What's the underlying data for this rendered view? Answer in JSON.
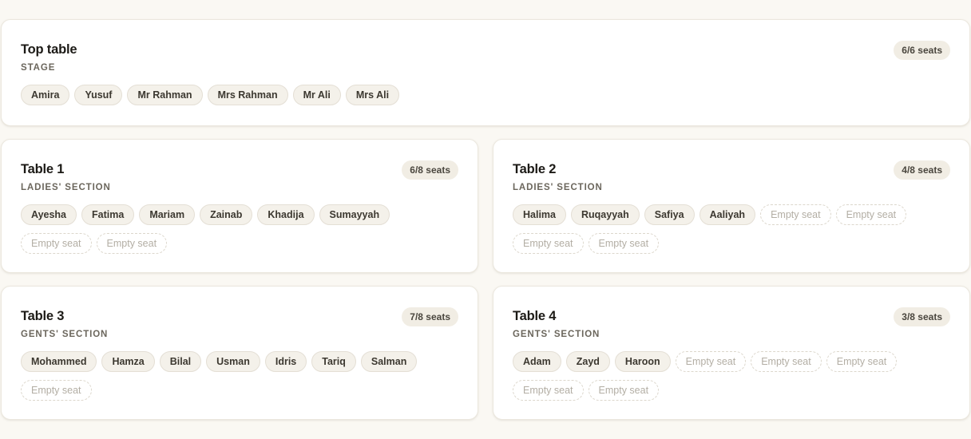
{
  "tables": [
    {
      "name": "Top table",
      "section": "STAGE",
      "seats": "6/6 seats",
      "guests": [
        "Amira",
        "Yusuf",
        "Mr Rahman",
        "Mrs Rahman",
        "Mr Ali",
        "Mrs Ali"
      ]
    },
    {
      "name": "Table 1",
      "section": "LADIES' SECTION",
      "seats": "6/8 seats",
      "guests": [
        "Ayesha",
        "Fatima",
        "Mariam",
        "Zainab",
        "Khadija",
        "Sumayyah",
        "Empty seat",
        "Empty seat"
      ]
    },
    {
      "name": "Table 2",
      "section": "LADIES' SECTION",
      "seats": "4/8 seats",
      "guests": [
        "Halima",
        "Ruqayyah",
        "Safiya",
        "Aaliyah",
        "Empty seat",
        "Empty seat",
        "Empty seat",
        "Empty seat"
      ]
    },
    {
      "name": "Table 3",
      "section": "GENTS' SECTION",
      "seats": "7/8 seats",
      "guests": [
        "Mohammed",
        "Hamza",
        "Bilal",
        "Usman",
        "Idris",
        "Tariq",
        "Salman",
        "Empty seat"
      ]
    },
    {
      "name": "Table 4",
      "section": "GENTS' SECTION",
      "seats": "3/8 seats",
      "guests": [
        "Adam",
        "Zayd",
        "Haroon",
        "Empty seat",
        "Empty seat",
        "Empty seat",
        "Empty seat",
        "Empty seat"
      ]
    }
  ]
}
